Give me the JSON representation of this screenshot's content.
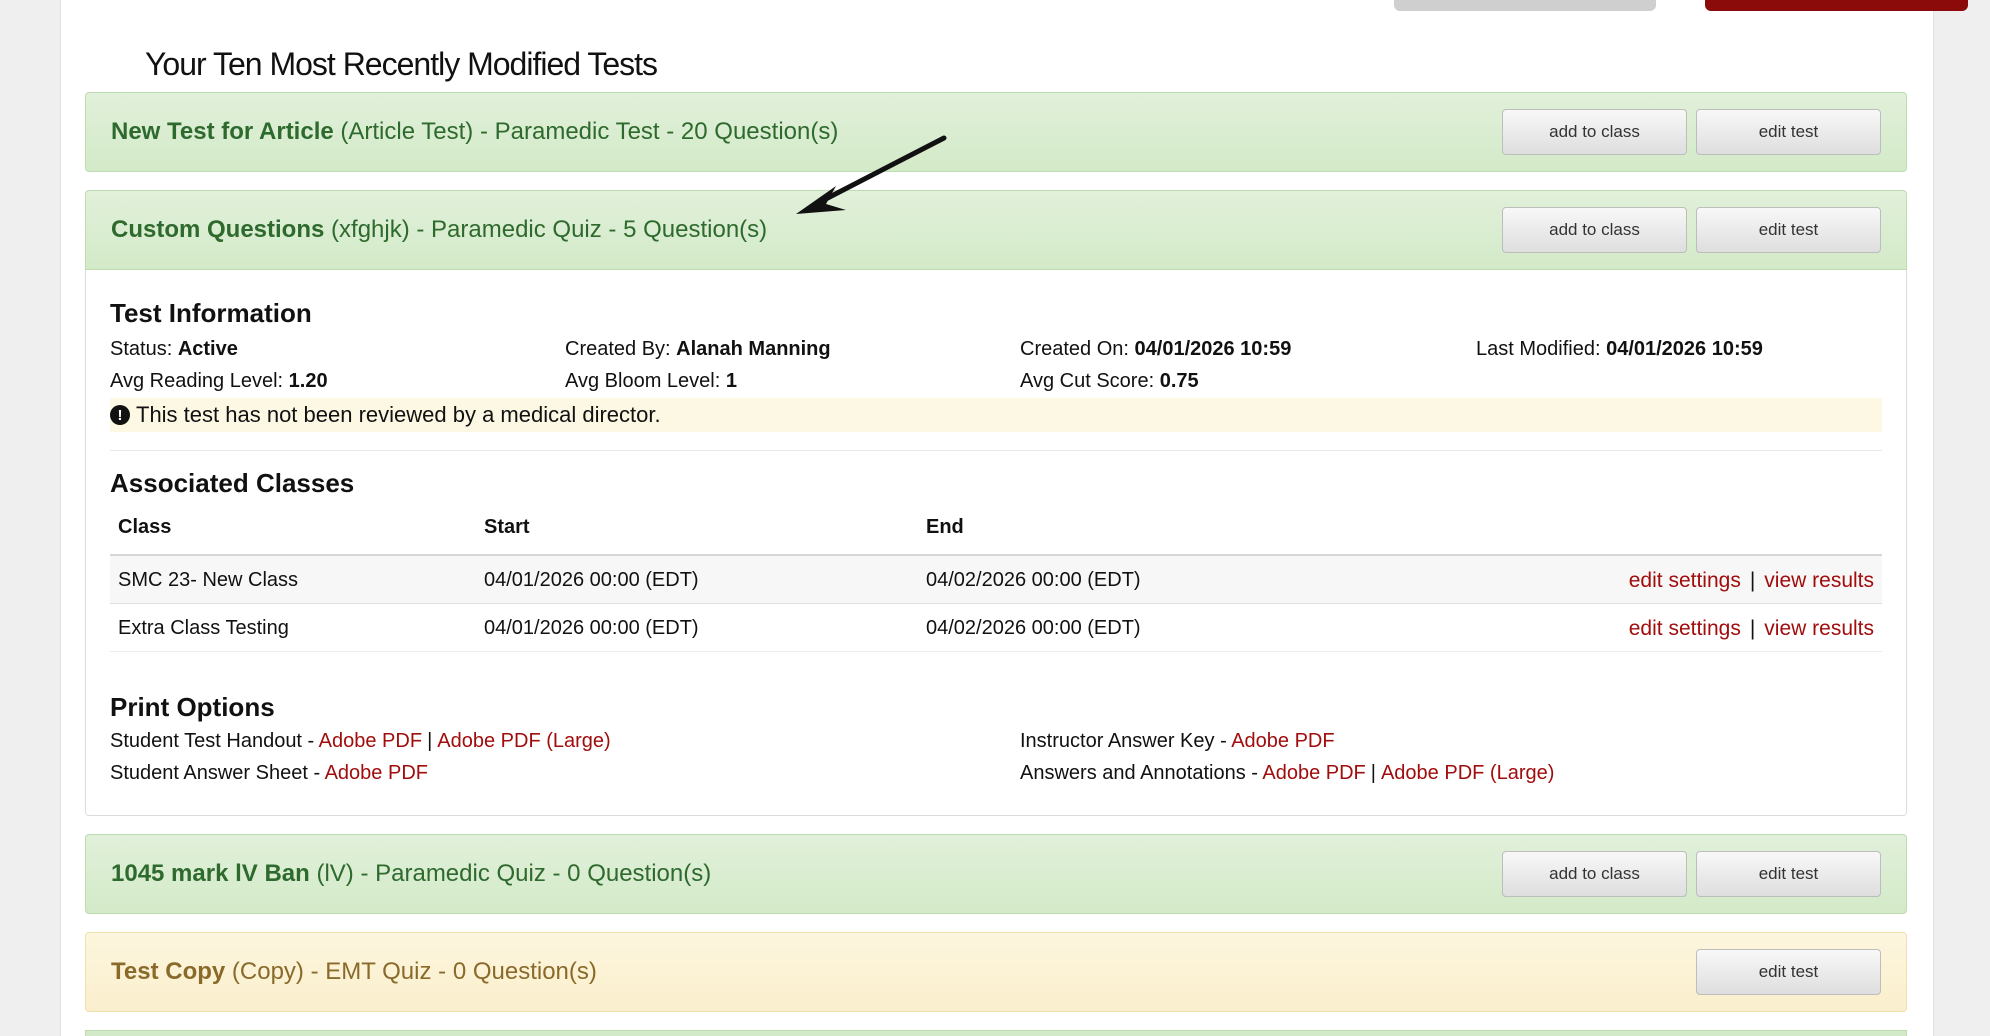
{
  "heading": "Your Ten Most Recently Modified Tests",
  "tests": [
    {
      "name": "New Test for Article",
      "meta": " (Article Test) - Paramedic Test - 20 Question(s)",
      "add_label": "add to class",
      "edit_label": "edit test"
    },
    {
      "name": "Custom Questions",
      "meta": " (xfghjk) - Paramedic Quiz - 5 Question(s)",
      "add_label": "add to class",
      "edit_label": "edit test"
    },
    {
      "name": "1045 mark lV Ban",
      "meta": " (lV) - Paramedic Quiz - 0 Question(s)",
      "add_label": "add to class",
      "edit_label": "edit test"
    },
    {
      "name": "Test Copy",
      "meta": " (Copy) - EMT Quiz - 0 Question(s)",
      "edit_label": "edit test"
    }
  ],
  "details": {
    "info_title": "Test Information",
    "status_label": "Status:",
    "status_value": "Active",
    "created_by_label": "Created By:",
    "created_by_value": "Alanah Manning",
    "created_on_label": "Created On:",
    "created_on_value": "04/01/2026 10:59",
    "modified_label": "Last Modified:",
    "modified_value": "04/01/2026 10:59",
    "reading_label": "Avg Reading Level:",
    "reading_value": "1.20",
    "bloom_label": "Avg Bloom Level:",
    "bloom_value": "1",
    "cut_label": "Avg Cut Score:",
    "cut_value": "0.75",
    "warning_icon": "!",
    "warning_text": "This test has not been reviewed by a medical director.",
    "classes_title": "Associated Classes",
    "col_class": "Class",
    "col_start": "Start",
    "col_end": "End",
    "classes": [
      {
        "name": "SMC 23- New Class",
        "start": "04/01/2026 00:00 (EDT)",
        "end": "04/02/2026 00:00 (EDT)",
        "edit": "edit settings",
        "sep": "|",
        "view": "view results"
      },
      {
        "name": "Extra Class Testing",
        "start": "04/01/2026 00:00 (EDT)",
        "end": "04/02/2026 00:00 (EDT)",
        "edit": "edit settings",
        "sep": "|",
        "view": "view results"
      }
    ],
    "print_title": "Print Options",
    "print": {
      "handout_label": "Student Test Handout - ",
      "handout_pdf": "Adobe PDF",
      "bar": "|",
      "handout_pdf_large": "Adobe PDF (Large)",
      "sheet_label": "Student Answer Sheet - ",
      "sheet_pdf": "Adobe PDF",
      "key_label": "Instructor Answer Key - ",
      "key_pdf": "Adobe PDF",
      "annot_label": "Answers and Annotations - ",
      "annot_pdf": "Adobe PDF",
      "annot_pdf_large": "Adobe PDF (Large)"
    }
  },
  "colors": {
    "link": "#a10c0c",
    "green_text": "#2e6a2e",
    "yellow_text": "#8a6a2a",
    "top_red_button": "#8b0a0a"
  }
}
